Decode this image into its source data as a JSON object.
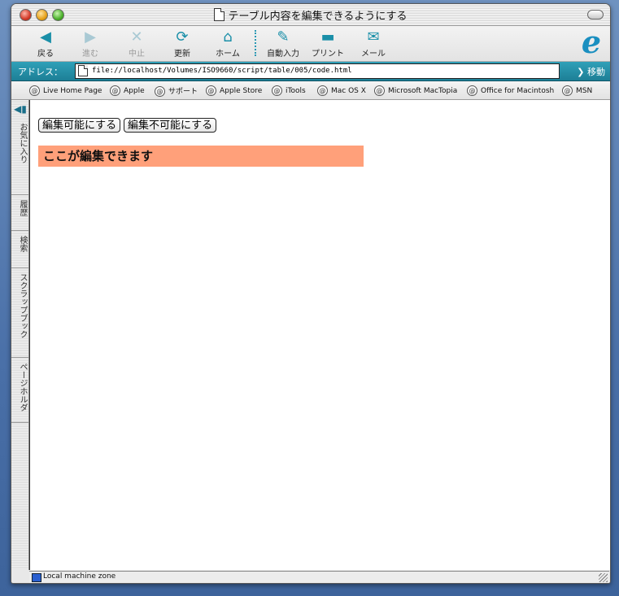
{
  "window": {
    "title": "テーブル内容を編集できるようにする"
  },
  "toolbar": {
    "back": "戻る",
    "forward": "進む",
    "stop": "中止",
    "refresh": "更新",
    "home": "ホーム",
    "autofill": "自動入力",
    "print": "プリント",
    "mail": "メール"
  },
  "address": {
    "label": "アドレス：",
    "url": "file://localhost/Volumes/ISO9660/script/table/005/code.html",
    "go": "移動"
  },
  "favorites": [
    "Live Home Page",
    "Apple",
    "サポート",
    "Apple Store",
    "iTools",
    "Mac OS X",
    "Microsoft MacTopia",
    "Office for Macintosh",
    "MSN"
  ],
  "sidebar_tabs": [
    "お気に入り",
    "履歴",
    "検索",
    "スクラップブック",
    "ページホルダ"
  ],
  "page": {
    "enable_button": "編集可能にする",
    "disable_button": "編集不可能にする",
    "editable_text": "ここが編集できます",
    "editable_bg": "#ffa07a"
  },
  "status": {
    "zone": "Local machine zone"
  }
}
